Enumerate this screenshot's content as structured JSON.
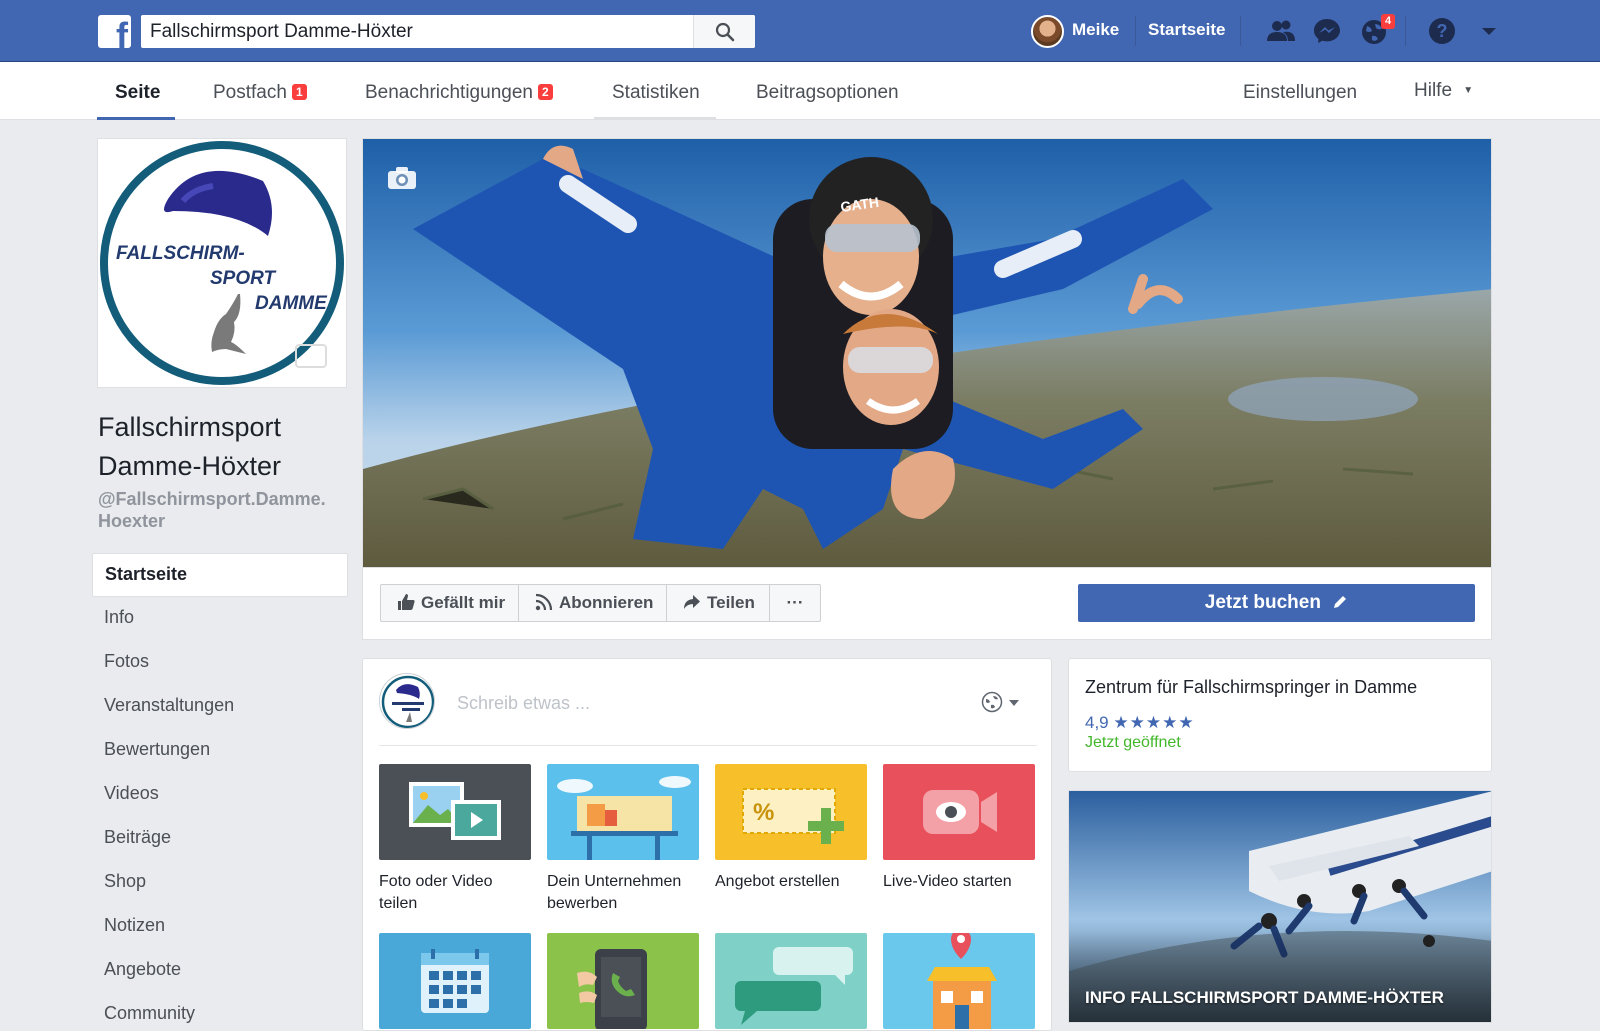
{
  "colors": {
    "brand": "#4267b2",
    "badge": "#fa3e3e",
    "open": "#42b72a"
  },
  "topbar": {
    "logo_letter": "f",
    "search_value": "Fallschirmsport Damme-Höxter",
    "user_name": "Meike",
    "home_label": "Startseite",
    "notifications_count": "4",
    "icons": [
      "friends-icon",
      "messenger-icon",
      "globe-icon",
      "help-icon",
      "caret-down-icon"
    ]
  },
  "navbar": {
    "tabs": [
      {
        "label": "Seite"
      },
      {
        "label": "Postfach",
        "badge": "1"
      },
      {
        "label": "Benachrichtigungen",
        "badge": "2"
      },
      {
        "label": "Statistiken"
      },
      {
        "label": "Beitragsoptionen"
      }
    ],
    "settings_label": "Einstellungen",
    "help_label": "Hilfe"
  },
  "profile": {
    "logo_text": [
      "FALLSCHIRM-",
      "SPORT",
      "DAMME"
    ],
    "name_line1": "Fallschirmsport",
    "name_line2": "Damme-Höxter",
    "handle_line1": "@Fallschirmsport.Damme.",
    "handle_line2": "Hoexter"
  },
  "left_nav": [
    {
      "label": "Startseite",
      "active": true
    },
    {
      "label": "Info"
    },
    {
      "label": "Fotos"
    },
    {
      "label": "Veranstaltungen"
    },
    {
      "label": "Bewertungen"
    },
    {
      "label": "Videos"
    },
    {
      "label": "Beiträge"
    },
    {
      "label": "Shop"
    },
    {
      "label": "Notizen"
    },
    {
      "label": "Angebote"
    },
    {
      "label": "Community"
    }
  ],
  "cover": {
    "helmet_text": "GATH"
  },
  "actions": {
    "like": "Gefällt mir",
    "follow": "Abonnieren",
    "share": "Teilen",
    "more": "···",
    "book": "Jetzt buchen"
  },
  "composer": {
    "placeholder": "Schreib etwas ...",
    "tiles": [
      {
        "label_line1": "Foto oder Video",
        "label_line2": "teilen",
        "color": "#4b4f56",
        "icon": "photo-video-icon"
      },
      {
        "label_line1": "Dein Unternehmen",
        "label_line2": "bewerben",
        "color": "#5bc0eb",
        "icon": "billboard-icon"
      },
      {
        "label_line1": "Angebot erstellen",
        "label_line2": "",
        "color": "#f7c02a",
        "icon": "offer-icon"
      },
      {
        "label_line1": "Live-Video starten",
        "label_line2": "",
        "color": "#e8505b",
        "icon": "live-video-icon"
      },
      {
        "color": "#4aa8d8",
        "icon": "calendar-icon"
      },
      {
        "color": "#8bc34a",
        "icon": "phone-icon"
      },
      {
        "color": "#7fd1c7",
        "icon": "chat-icon"
      },
      {
        "color": "#6ac8ec",
        "icon": "location-icon"
      }
    ]
  },
  "about": {
    "title": "Zentrum für Fallschirmspringer in Damme",
    "rating": "4,9",
    "stars": "★★★★★",
    "rating_value": 4.9,
    "status": "Jetzt geöffnet"
  },
  "info_card": {
    "label": "INFO FALLSCHIRMSPORT DAMME-HÖXTER"
  }
}
